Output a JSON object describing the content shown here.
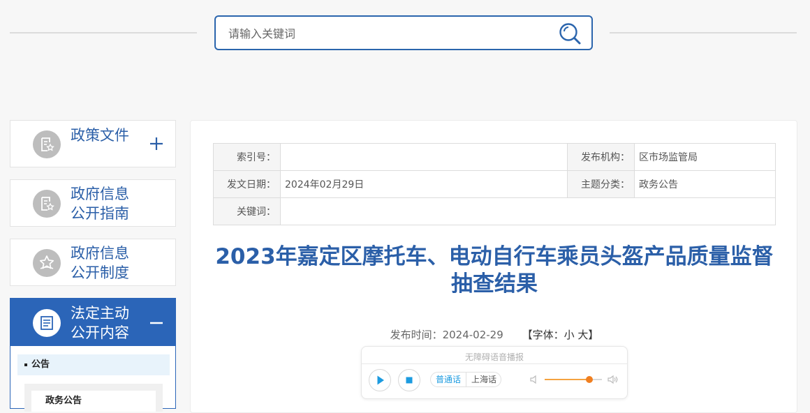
{
  "search": {
    "placeholder": "请输入关键词"
  },
  "sidebar": {
    "items": [
      {
        "label": "政策文件",
        "toggle": "+"
      },
      {
        "label_line1": "政府信息",
        "label_line2": "公开指南"
      },
      {
        "label_line1": "政府信息",
        "label_line2": "公开制度"
      },
      {
        "label_line1": "法定主动",
        "label_line2": "公开内容",
        "toggle": "−"
      }
    ],
    "sub_items": [
      {
        "label": "公告"
      }
    ],
    "sub_sub_items": [
      {
        "label": "政务公告"
      }
    ]
  },
  "meta": {
    "index_label": "索引号：",
    "index_value": "",
    "org_label": "发布机构：",
    "org_value": "区市场监管局",
    "date_label": "发文日期：",
    "date_value": "2024年02月29日",
    "topic_label": "主题分类：",
    "topic_value": "政务公告",
    "keyword_label": "关键词：",
    "keyword_value": ""
  },
  "article": {
    "title": "2023年嘉定区摩托车、电动自行车乘员头盔产品质量监督抽查结果",
    "publish_label": "发布时间：",
    "publish_date": "2024-02-29",
    "font_label_open": "【字体：",
    "font_small": "小",
    "font_large": "大",
    "font_label_close": "】"
  },
  "player": {
    "title": "无障碍语音播报",
    "lang_mandarin": "普通话",
    "lang_shanghai": "上海话",
    "volume": 0.78,
    "accent_color": "#1c9be0",
    "volume_color": "#f07f20"
  },
  "colors": {
    "primary": "#2b65b8",
    "title": "#2b5fa8"
  }
}
